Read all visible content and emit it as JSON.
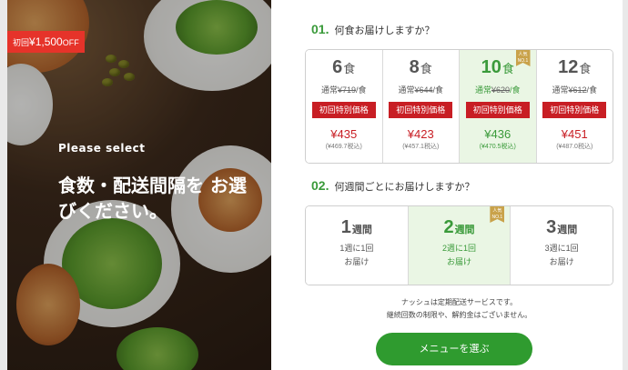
{
  "hero": {
    "offer_prefix": "初回",
    "offer_amount": "¥1,500",
    "offer_suffix": "OFF",
    "eyebrow": "Please select",
    "title": "食数・配送間隔を お選びください。"
  },
  "q1": {
    "num": "01.",
    "label": "何食お届けしますか？"
  },
  "meals": [
    {
      "count": "6",
      "unit": "食",
      "regular_prefix": "通常",
      "regular_price": "¥719",
      "regular_suffix": "/食",
      "promo": "初回特別価格",
      "price": "¥435",
      "tax": "(¥469.7税込)",
      "selected": false
    },
    {
      "count": "8",
      "unit": "食",
      "regular_prefix": "通常",
      "regular_price": "¥644",
      "regular_suffix": "/食",
      "promo": "初回特別価格",
      "price": "¥423",
      "tax": "(¥457.1税込)",
      "selected": false
    },
    {
      "count": "10",
      "unit": "食",
      "regular_prefix": "通常",
      "regular_price": "¥620",
      "regular_suffix": "/食",
      "promo": "初回特別価格",
      "price": "¥436",
      "tax": "(¥470.5税込)",
      "selected": true,
      "badge": "人気 NO.1"
    },
    {
      "count": "12",
      "unit": "食",
      "regular_prefix": "通常",
      "regular_price": "¥612",
      "regular_suffix": "/食",
      "promo": "初回特別価格",
      "price": "¥451",
      "tax": "(¥487.0税込)",
      "selected": false
    }
  ],
  "q2": {
    "num": "02.",
    "label": "何週間ごとにお届けしますか？"
  },
  "weeks": [
    {
      "count": "1",
      "unit": "週間",
      "line1": "1週に1回",
      "line2": "お届け",
      "selected": false
    },
    {
      "count": "2",
      "unit": "週間",
      "line1": "2週に1回",
      "line2": "お届け",
      "selected": true,
      "badge": "人気 NO.1"
    },
    {
      "count": "3",
      "unit": "週間",
      "line1": "3週に1回",
      "line2": "お届け",
      "selected": false
    }
  ],
  "note": {
    "line1": "ナッシュは定期配送サービスです。",
    "line2": "継続回数の制限や、解約金はございません。"
  },
  "cta": {
    "label": "メニューを選ぶ"
  }
}
